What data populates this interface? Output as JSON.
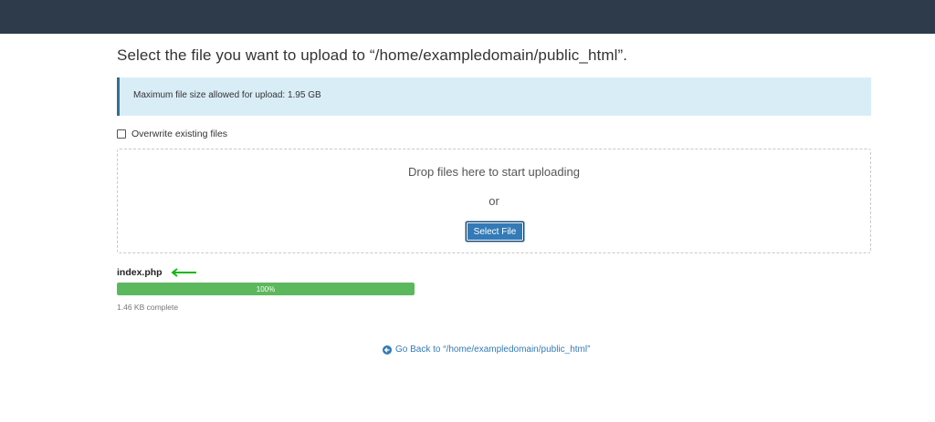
{
  "page": {
    "title": "Select the file you want to upload to “/home/exampledomain/public_html”."
  },
  "info": {
    "max_size_text": "Maximum file size allowed for upload: 1.95 GB"
  },
  "options": {
    "overwrite_label": "Overwrite existing files",
    "overwrite_checked": false
  },
  "dropzone": {
    "drop_text": "Drop files here to start uploading",
    "or_text": "or",
    "select_button_label": "Select File"
  },
  "upload": {
    "file_name": "index.php",
    "progress_percent": 100,
    "progress_label": "100%",
    "complete_text": "1.46 KB complete"
  },
  "footer": {
    "back_link_text": "Go Back to “/home/exampledomain/public_html”"
  },
  "icons": {
    "arrow": "arrow-left-icon",
    "back": "circle-arrow-left-icon"
  },
  "colors": {
    "topbar": "#2d3b4b",
    "info_bg": "#d9edf7",
    "primary": "#337ab7",
    "success": "#5cb85c",
    "annotation_arrow": "#11b711"
  }
}
